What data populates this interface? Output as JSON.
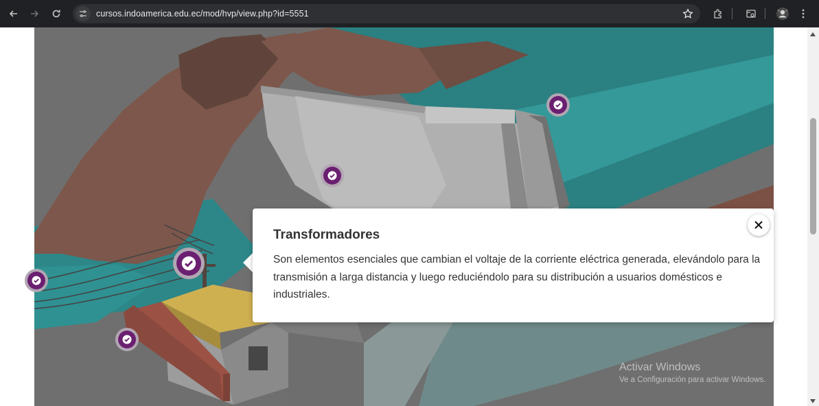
{
  "browser": {
    "url": "cursos.indoamerica.edu.ec/mod/hvp/view.php?id=5551",
    "back_icon": "arrow-left-icon",
    "forward_icon": "arrow-right-icon",
    "reload_icon": "reload-icon",
    "site_info_icon": "tune-icon",
    "bookmark_icon": "star-icon",
    "extensions_icon": "puzzle-icon",
    "tab_search_icon": "tab-search-icon",
    "profile_icon": "avatar-icon",
    "menu_icon": "kebab-menu-icon"
  },
  "popup": {
    "title": "Transformadores",
    "body": "Son elementos esenciales que cambian el voltaje de la corriente eléctrica generada, elevándolo para la transmisión a larga distancia y luego reduciéndolo para su distribución a usuarios domésticos e industriales.",
    "close_icon": "close-icon"
  },
  "hotspots": [
    {
      "name": "hotspot-reservoir",
      "state": "visited"
    },
    {
      "name": "hotspot-dam-wall",
      "state": "visited"
    },
    {
      "name": "hotspot-transformers",
      "state": "active"
    },
    {
      "name": "hotspot-power-lines",
      "state": "visited"
    },
    {
      "name": "hotspot-powerhouse",
      "state": "visited"
    }
  ],
  "watermark": {
    "line1": "Activar Windows",
    "line2": "Ve a Configuración para activar Windows."
  },
  "colors": {
    "hotspot": "#6b1f70",
    "water": "#1a9a9c",
    "rock": "#8a5040",
    "browser_bar": "#202124"
  }
}
